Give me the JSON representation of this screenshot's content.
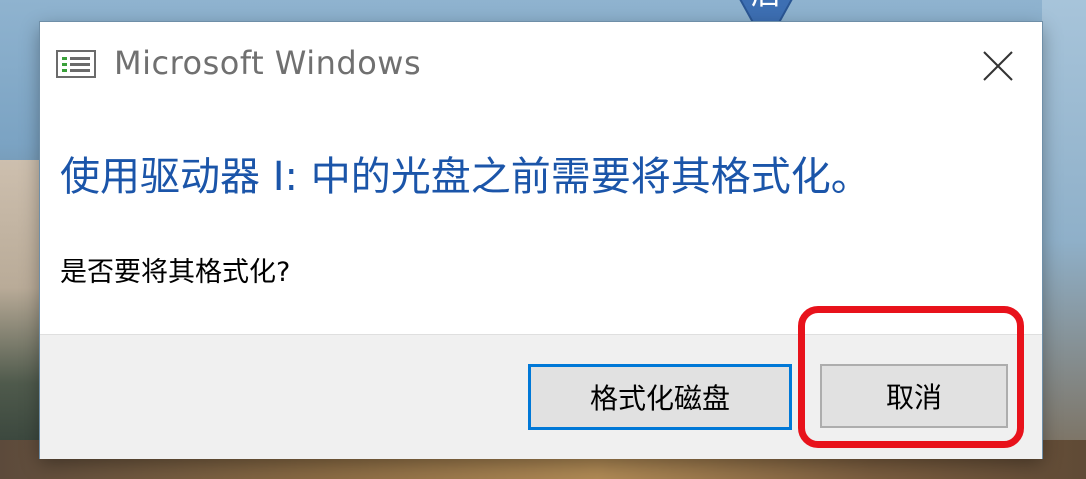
{
  "window": {
    "title": "Microsoft Windows",
    "icon": "app-window-icon",
    "close_icon": "close-icon"
  },
  "message": {
    "main_instruction": "使用驱动器 I: 中的光盘之前需要将其格式化。",
    "question": "是否要将其格式化?"
  },
  "buttons": {
    "format_label": "格式化磁盘",
    "cancel_label": "取消"
  },
  "annotation": {
    "callout_text": "后",
    "highlight_color": "#e8121b"
  },
  "colors": {
    "instruction_text": "#1b55a9",
    "default_button_border": "#0078d7",
    "footer_bg": "#f0f0f0"
  }
}
